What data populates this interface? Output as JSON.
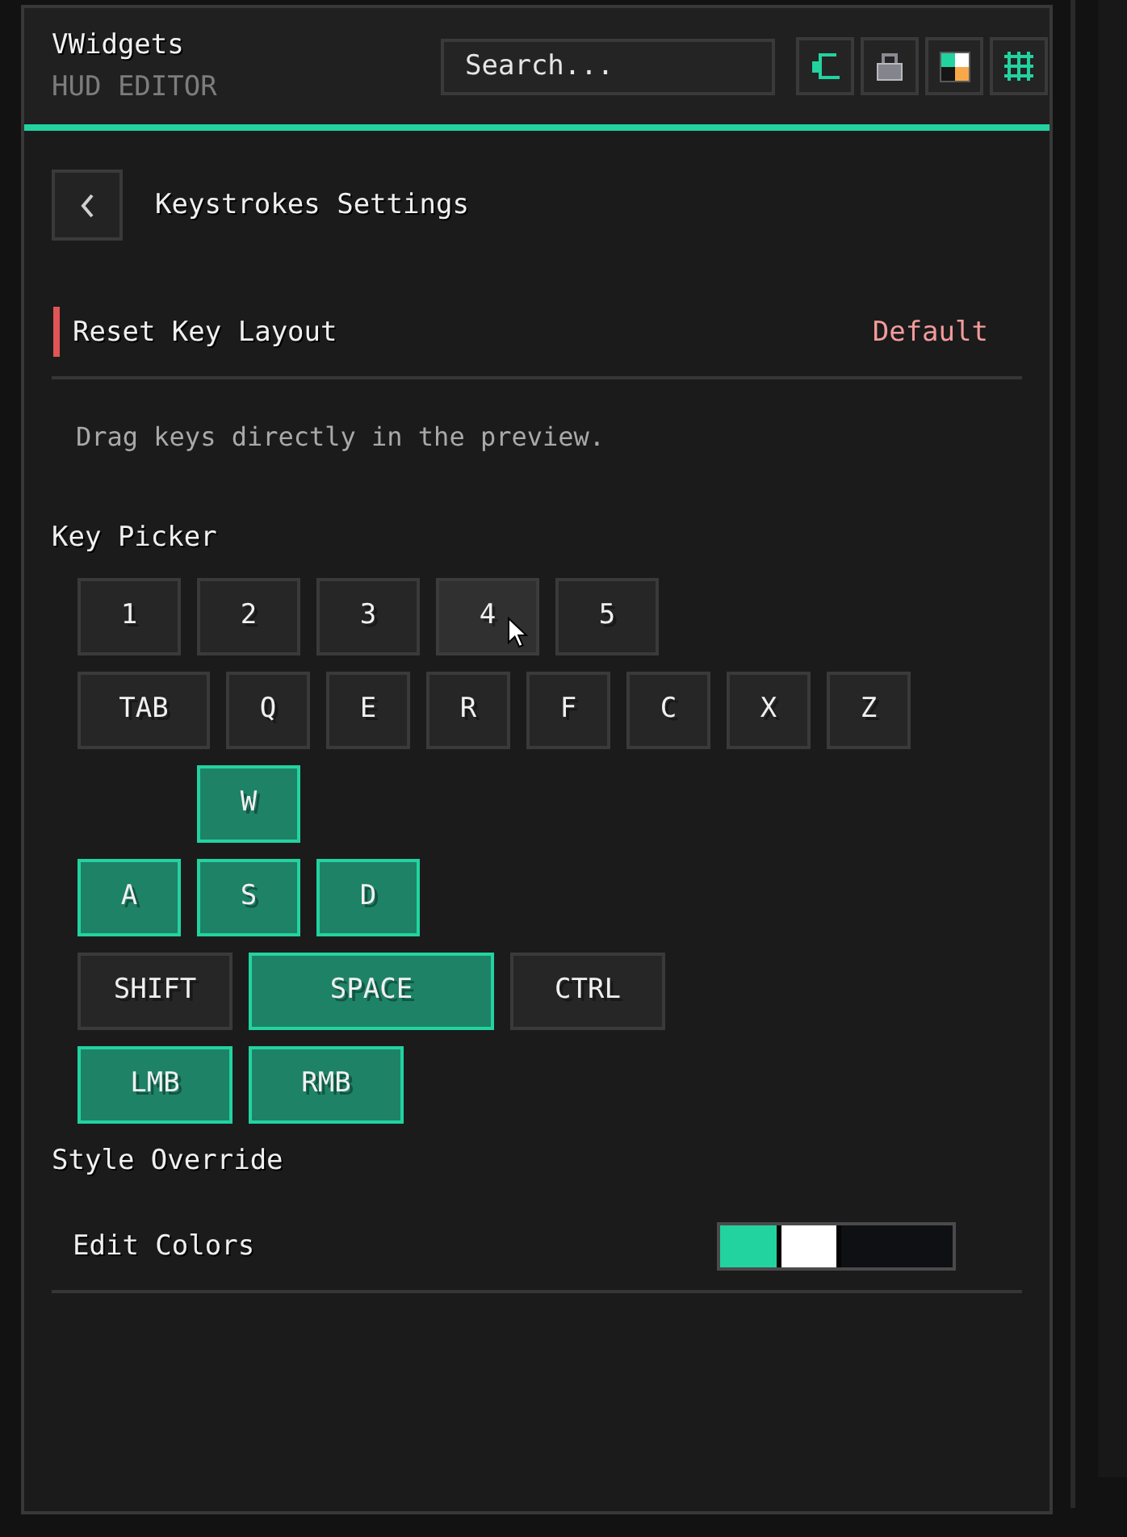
{
  "header": {
    "title": "VWidgets",
    "subtitle": "HUD EDITOR",
    "search": {
      "placeholder": "Search..."
    },
    "tools": [
      {
        "kind": "bracket"
      },
      {
        "kind": "lock"
      },
      {
        "kind": "quadrants"
      },
      {
        "kind": "grid"
      }
    ]
  },
  "page": {
    "title": "Keystrokes Settings"
  },
  "reset": {
    "label": "Reset Key Layout",
    "value": "Default"
  },
  "hint": "Drag keys directly in the preview.",
  "key_picker": {
    "title": "Key Picker",
    "rows": [
      {
        "kind": "line",
        "keys": [
          {
            "label": "1",
            "kind": "digit",
            "selected": false,
            "hovered": false
          },
          {
            "label": "2",
            "kind": "digit",
            "selected": false,
            "hovered": false
          },
          {
            "label": "3",
            "kind": "digit",
            "selected": false,
            "hovered": false
          },
          {
            "label": "4",
            "kind": "digit",
            "selected": false,
            "hovered": true
          },
          {
            "label": "5",
            "kind": "digit",
            "selected": false,
            "hovered": false
          }
        ]
      },
      {
        "kind": "line",
        "keys": [
          {
            "label": "TAB",
            "kind": "tab",
            "selected": false,
            "hovered": false
          },
          {
            "label": "Q",
            "kind": "letter",
            "selected": false,
            "hovered": false
          },
          {
            "label": "E",
            "kind": "letter",
            "selected": false,
            "hovered": false
          },
          {
            "label": "R",
            "kind": "letter",
            "selected": false,
            "hovered": false
          },
          {
            "label": "F",
            "kind": "letter",
            "selected": false,
            "hovered": false
          },
          {
            "label": "C",
            "kind": "letter",
            "selected": false,
            "hovered": false
          },
          {
            "label": "X",
            "kind": "letter",
            "selected": false,
            "hovered": false
          },
          {
            "label": "Z",
            "kind": "letter",
            "selected": false,
            "hovered": false
          }
        ]
      },
      {
        "kind": "cluster",
        "keys": [
          {
            "label": "W",
            "kind": "movement",
            "selected": true,
            "hovered": false
          },
          {
            "label": "A",
            "kind": "movement",
            "selected": true,
            "hovered": false
          },
          {
            "label": "S",
            "kind": "movement",
            "selected": true,
            "hovered": false
          },
          {
            "label": "D",
            "kind": "movement",
            "selected": true,
            "hovered": false
          }
        ]
      },
      {
        "kind": "line",
        "keys": [
          {
            "label": "SHIFT",
            "kind": "modifier",
            "selected": false,
            "hovered": false
          },
          {
            "label": "SPACE",
            "kind": "space",
            "selected": true,
            "hovered": false
          },
          {
            "label": "CTRL",
            "kind": "modifier",
            "selected": false,
            "hovered": false
          }
        ]
      },
      {
        "kind": "line",
        "keys": [
          {
            "label": "LMB",
            "kind": "mouse",
            "selected": true,
            "hovered": false
          },
          {
            "label": "RMB",
            "kind": "mouse",
            "selected": true,
            "hovered": false
          }
        ]
      }
    ]
  },
  "style_override": {
    "title": "Style Override",
    "rows": [
      {
        "label": "Edit Colors",
        "swatches": [
          {
            "color": "#22d3a0"
          },
          {
            "color": "#ffffff"
          },
          {
            "color": "#0e1014"
          }
        ]
      }
    ]
  }
}
